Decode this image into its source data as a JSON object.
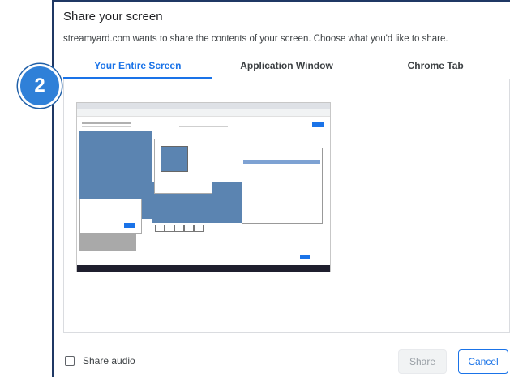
{
  "dialog": {
    "title": "Share your screen",
    "subtitle": "streamyard.com wants to share the contents of your screen. Choose what you'd like to share."
  },
  "tabs": [
    {
      "label": "Your Entire Screen",
      "selected": true
    },
    {
      "label": "Application Window",
      "selected": false
    },
    {
      "label": "Chrome Tab",
      "selected": false
    }
  ],
  "footer": {
    "share_audio_label": "Share audio",
    "share_audio_checked": false,
    "share_button_label": "Share",
    "share_button_enabled": false,
    "cancel_button_label": "Cancel"
  },
  "step_badge": "2",
  "colors": {
    "accent": "#1a73e8",
    "badge": "#2f80d8",
    "border": "#1f3864"
  },
  "icons": {
    "thumbnail": "screen-preview-icon"
  }
}
